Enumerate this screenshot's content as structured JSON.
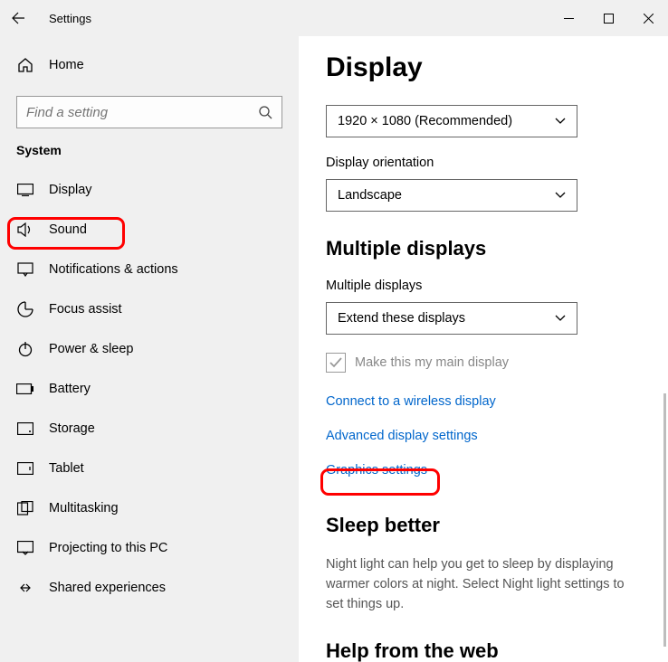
{
  "titlebar": {
    "title": "Settings"
  },
  "sidebar": {
    "home_label": "Home",
    "search_placeholder": "Find a setting",
    "section": "System",
    "items": [
      {
        "label": "Display"
      },
      {
        "label": "Sound"
      },
      {
        "label": "Notifications & actions"
      },
      {
        "label": "Focus assist"
      },
      {
        "label": "Power & sleep"
      },
      {
        "label": "Battery"
      },
      {
        "label": "Storage"
      },
      {
        "label": "Tablet"
      },
      {
        "label": "Multitasking"
      },
      {
        "label": "Projecting to this PC"
      },
      {
        "label": "Shared experiences"
      }
    ]
  },
  "main": {
    "title": "Display",
    "resolution": {
      "value": "1920 × 1080 (Recommended)"
    },
    "orientation": {
      "label": "Display orientation",
      "value": "Landscape"
    },
    "multiple_heading": "Multiple displays",
    "multiple": {
      "label": "Multiple displays",
      "value": "Extend these displays"
    },
    "main_display_checkbox": "Make this my main display",
    "links": {
      "wireless": "Connect to a wireless display",
      "advanced": "Advanced display settings",
      "graphics": "Graphics settings"
    },
    "sleep_heading": "Sleep better",
    "sleep_text": "Night light can help you get to sleep by displaying warmer colors at night. Select Night light settings to set things up.",
    "help_heading": "Help from the web"
  }
}
